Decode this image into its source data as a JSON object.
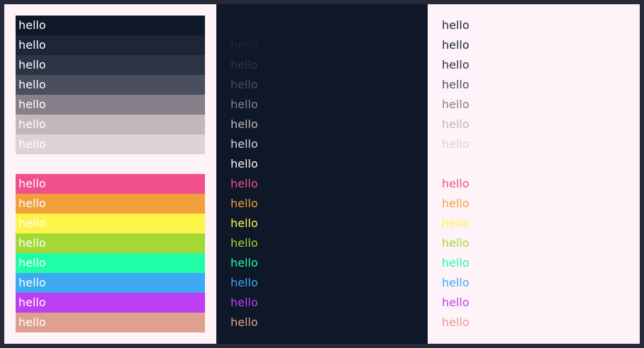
{
  "sample_text": "hello",
  "palette": {
    "backgrounds": {
      "frame": "#262a38",
      "light_panel": "#fef3f8",
      "dark_panel": "#0e1828"
    },
    "shades": [
      "#0e1828",
      "#1d2536",
      "#2d3446",
      "#4a4f5e",
      "#858089",
      "#c4b7bc",
      "#ded1d7"
    ],
    "dark_panel_extra_shade": "#fef3f8",
    "accents": [
      "#f2508a",
      "#f2a03c",
      "#fff54a",
      "#a3d837",
      "#20fda8",
      "#3ea9f2",
      "#bd3ff4",
      "#e0a090"
    ]
  }
}
